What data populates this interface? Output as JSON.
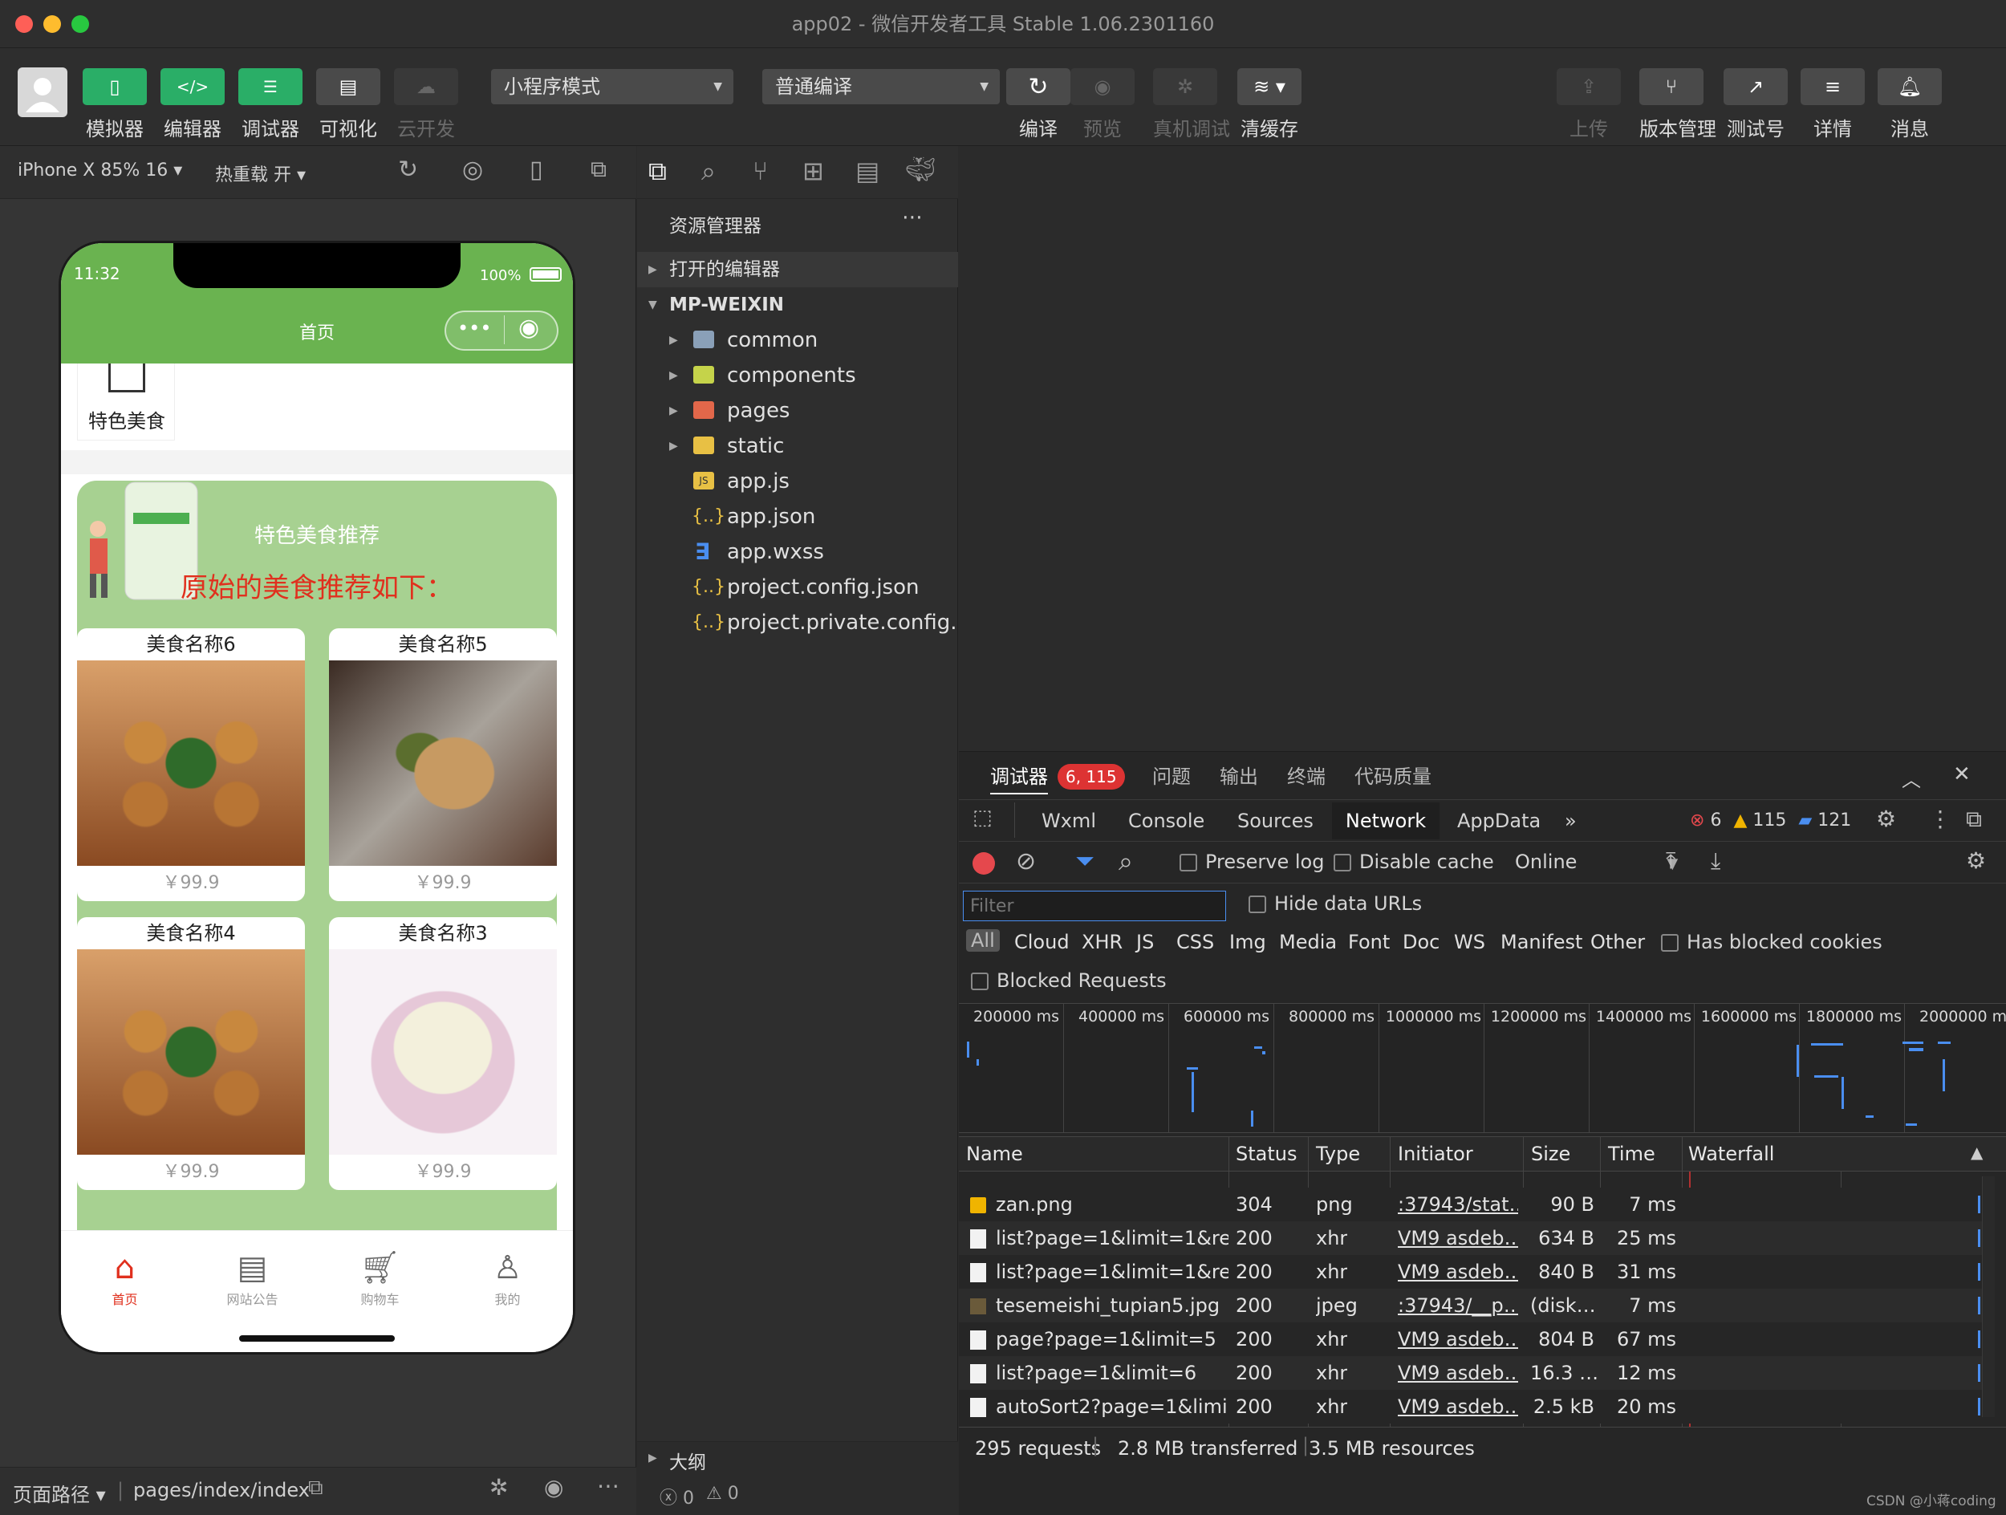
{
  "window": {
    "title": "app02 - 微信开发者工具 Stable 1.06.2301160"
  },
  "toolbar": {
    "left": [
      "模拟器",
      "编辑器",
      "调试器",
      "可视化",
      "云开发"
    ],
    "mode_select": "小程序模式",
    "compile_select": "普通编译",
    "center": [
      "编译",
      "预览",
      "真机调试",
      "清缓存"
    ],
    "right": [
      "上传",
      "版本管理",
      "测试号",
      "详情",
      "消息"
    ]
  },
  "sim": {
    "device": "iPhone X 85% 16",
    "hot_reload": "热重载 开",
    "footer_path_label": "页面路径",
    "footer_path": "pages/index/index"
  },
  "phone": {
    "time": "11:32",
    "battery": "100%",
    "nav_title": "首页",
    "category_label": "特色美食",
    "rec_title": "特色美食推荐",
    "rec_subtitle": "原始的美食推荐如下：",
    "cards": [
      {
        "name": "美食名称6",
        "price": "￥99.9"
      },
      {
        "name": "美食名称5",
        "price": "￥99.9"
      },
      {
        "name": "美食名称4",
        "price": "￥99.9"
      },
      {
        "name": "美食名称3",
        "price": "￥99.9"
      }
    ],
    "tabs": [
      "首页",
      "网站公告",
      "购物车",
      "我的"
    ]
  },
  "explorer": {
    "title": "资源管理器",
    "open_editors": "打开的编辑器",
    "project": "MP-WEIXIN",
    "folders": [
      "common",
      "components",
      "pages",
      "static"
    ],
    "files": [
      "app.js",
      "app.json",
      "app.wxss",
      "project.config.json",
      "project.private.config..."
    ],
    "outline": "大纲",
    "errors": "0",
    "warnings": "0"
  },
  "debugger": {
    "tabs": {
      "debug": "调试器",
      "badge": "6, 115",
      "issues": "问题",
      "output": "输出",
      "terminal": "终端",
      "quality": "代码质量"
    },
    "devtools_tabs": [
      "Wxml",
      "Console",
      "Sources",
      "Network",
      "AppData"
    ],
    "counts": {
      "errors": "6",
      "warnings": "115",
      "info": "121"
    },
    "net": {
      "preserve_log": "Preserve log",
      "disable_cache": "Disable cache",
      "throttle": "Online",
      "filter_placeholder": "Filter",
      "hide_data_urls": "Hide data URLs",
      "types": [
        "All",
        "Cloud",
        "XHR",
        "JS",
        "CSS",
        "Img",
        "Media",
        "Font",
        "Doc",
        "WS",
        "Manifest",
        "Other"
      ],
      "has_blocked_cookies": "Has blocked cookies",
      "blocked_requests": "Blocked Requests",
      "ticks": [
        "200000 ms",
        "400000 ms",
        "600000 ms",
        "800000 ms",
        "1000000 ms",
        "1200000 ms",
        "1400000 ms",
        "1600000 ms",
        "1800000 ms",
        "2000000 ms"
      ],
      "columns": [
        "Name",
        "Status",
        "Type",
        "Initiator",
        "Size",
        "Time",
        "Waterfall"
      ],
      "rows": [
        {
          "name": "zan.png",
          "status": "304",
          "type": "png",
          "initiator": ":37943/stat…",
          "size": "90 B",
          "time": "7 ms"
        },
        {
          "name": "list?page=1&limit=1&re…",
          "status": "200",
          "type": "xhr",
          "initiator": "VM9 asdeb…",
          "size": "634 B",
          "time": "25 ms"
        },
        {
          "name": "list?page=1&limit=1&re…",
          "status": "200",
          "type": "xhr",
          "initiator": "VM9 asdeb…",
          "size": "840 B",
          "time": "31 ms"
        },
        {
          "name": "tesemeishi_tupian5.jpg",
          "status": "200",
          "type": "jpeg",
          "initiator": ":37943/__p…",
          "size": "(disk…",
          "time": "7 ms"
        },
        {
          "name": "page?page=1&limit=5",
          "status": "200",
          "type": "xhr",
          "initiator": "VM9 asdeb…",
          "size": "804 B",
          "time": "67 ms"
        },
        {
          "name": "list?page=1&limit=6",
          "status": "200",
          "type": "xhr",
          "initiator": "VM9 asdeb…",
          "size": "16.3 …",
          "time": "12 ms"
        },
        {
          "name": "autoSort2?page=1&limi…",
          "status": "200",
          "type": "xhr",
          "initiator": "VM9 asdeb…",
          "size": "2.5 kB",
          "time": "20 ms"
        }
      ],
      "summary": {
        "requests": "295 requests",
        "transferred": "2.8 MB transferred",
        "resources": "3.5 MB resources"
      }
    }
  },
  "watermark": "CSDN @小蒋coding"
}
